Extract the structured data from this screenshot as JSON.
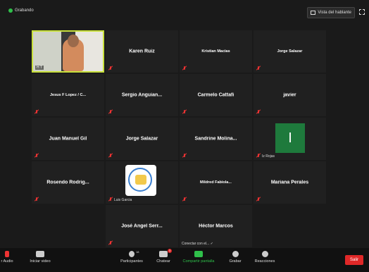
{
  "header": {
    "recording_label": "Grabando",
    "view_button_label": "Vista del hablante"
  },
  "participants": [
    {
      "name": "",
      "video_tag": "H T"
    },
    {
      "name": "Karen Ruiz"
    },
    {
      "name": "Kristian Macias"
    },
    {
      "name": "Jorge Salazar"
    },
    {
      "name": "Jesus F Lopez / C..."
    },
    {
      "name": "Sergio Anguian..."
    },
    {
      "name": "Carmelo Cattafi"
    },
    {
      "name": "javier"
    },
    {
      "name": "Juan Manuel Gil"
    },
    {
      "name": "Jorge Salazar"
    },
    {
      "name": "Sandrine Molina..."
    },
    {
      "name": "",
      "avatar_letter": "I",
      "tag": "Iz Rojas"
    },
    {
      "name": "Rosendo Rodrig..."
    },
    {
      "name": "",
      "tag": "Luis Garcia"
    },
    {
      "name": "Mildred Fabiola..."
    },
    {
      "name": "Mariana Perales"
    },
    {
      "name": "José Angel Serr..."
    },
    {
      "name": "Héctor Marcos",
      "tag": "Conectar con el... ✓"
    }
  ],
  "toolbar": {
    "audio_label": "r Audio",
    "video_label": "Iniciar video",
    "participants_label": "Participantes",
    "participants_count": "18",
    "chat_label": "Chatear",
    "chat_badge": "3",
    "share_label": "Compartir pantalla",
    "record_label": "Grabar",
    "reactions_label": "Reacciones",
    "leave_label": "Salir"
  }
}
